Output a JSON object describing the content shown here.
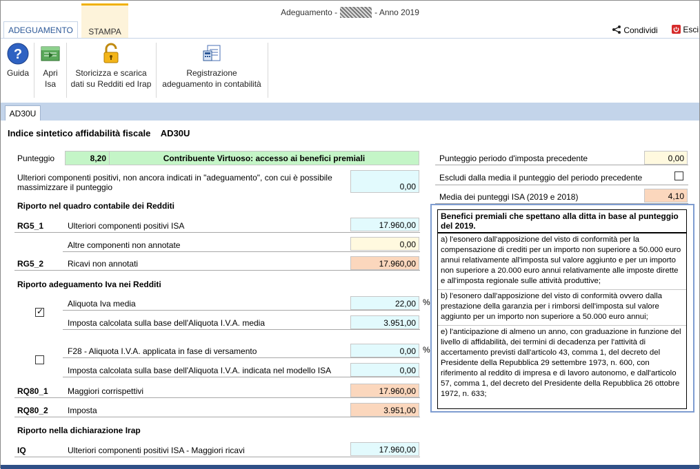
{
  "window": {
    "title_prefix": "Adeguamento -",
    "title_suffix": "- Anno 2019"
  },
  "ribbon_tabs": [
    "ADEGUAMENTO",
    "STAMPA"
  ],
  "top_actions": {
    "share": "Condividi",
    "exit": "Esci"
  },
  "ribbon": {
    "guida": "Guida",
    "apri_isa_1": "Apri",
    "apri_isa_2": "Isa",
    "storicizza_1": "Storicizza e scarica",
    "storicizza_2": "dati su Redditi ed Irap",
    "registrazione_1": "Registrazione",
    "registrazione_2": "adeguamento in contabilità"
  },
  "doc_tab": "AD30U",
  "header": {
    "title": "Indice sintetico affidabilità fiscale",
    "code": "AD30U"
  },
  "punteggio": {
    "label": "Punteggio",
    "value": "8,20",
    "status": "Contribuente Virtuoso: accesso ai benefici premiali"
  },
  "ulteriori": {
    "label_1": "Ulteriori componenti positivi, non ancora indicati in \"adeguamento\", con cui è possibile",
    "label_2": "massimizzare il punteggio",
    "value": "0,00"
  },
  "redditi": {
    "section": "Riporto nel quadro contabile dei Redditi",
    "rg5_1_code": "RG5_1",
    "rg5_1_label": "Ulteriori componenti positivi ISA",
    "rg5_1_value": "17.960,00",
    "altre_label": "Altre componenti non annotate",
    "altre_value": "0,00",
    "rg5_2_code": "RG5_2",
    "rg5_2_label": "Ricavi non annotati",
    "rg5_2_value": "17.960,00"
  },
  "iva": {
    "section": "Riporto adeguamento Iva nei Redditi",
    "aliquota_label": "Aliquota Iva media",
    "aliquota_value": "22,00",
    "percent": "%",
    "imposta_media_label": "Imposta calcolata sulla base dell'Aliquota I.V.A. media",
    "imposta_media_value": "3.951,00",
    "f28_label": "F28 - Aliquota I.V.A. applicata in fase di versamento",
    "f28_value": "0,00",
    "imposta_isa_label": "Imposta calcolata sulla base dell'Aliquota I.V.A. indicata nel modello ISA",
    "imposta_isa_value": "0,00",
    "rq80_1_code": "RQ80_1",
    "rq80_1_label": "Maggiori corrispettivi",
    "rq80_1_value": "17.960,00",
    "rq80_2_code": "RQ80_2",
    "rq80_2_label": "Imposta",
    "rq80_2_value": "3.951,00"
  },
  "irap": {
    "section": "Riporto nella dichiarazione Irap",
    "iq_code": "IQ",
    "iq_label": "Ulteriori componenti positivi ISA - Maggiori ricavi",
    "iq_value": "17.960,00"
  },
  "right": {
    "prev_label": "Punteggio periodo d'imposta precedente",
    "prev_value": "0,00",
    "escludi_label": "Escludi dalla media il punteggio del periodo precedente",
    "media_label": "Media dei punteggi ISA (2019 e 2018)",
    "media_value": "4,10"
  },
  "benefits": {
    "title": "Benefici premiali che spettano alla ditta in base al punteggio del 2019.",
    "a": "a) l'esonero dall'apposizione del visto di conformità per la compensazione di crediti per un importo non superiore a 50.000 euro annui relativamente all'imposta sul valore aggiunto e per un importo non superiore a 20.000 euro annui relativamente alle imposte dirette e all'imposta regionale sulle attività produttive;",
    "b": "b) l'esonero dall'apposizione del visto di conformità ovvero dalla prestazione della garanzia per i rimborsi dell'imposta sul valore aggiunto per un importo non superiore a 50.000 euro annui;",
    "e": "e) l'anticipazione di almeno un anno, con graduazione in funzione del livello di affidabilità, dei termini di decadenza per l'attività di accertamento previsti dall'articolo 43, comma 1, del decreto del Presidente della Repubblica 29 settembre 1973, n. 600, con riferimento al reddito di impresa e di lavoro autonomo, e dall'articolo 57, comma 1, del decreto del Presidente della Repubblica 26 ottobre 1972, n. 633;"
  },
  "colors": {
    "accent": "#2b5797",
    "cyan": "#e2fafd",
    "orange": "#fbd7bd",
    "green": "#c4f5c7"
  }
}
